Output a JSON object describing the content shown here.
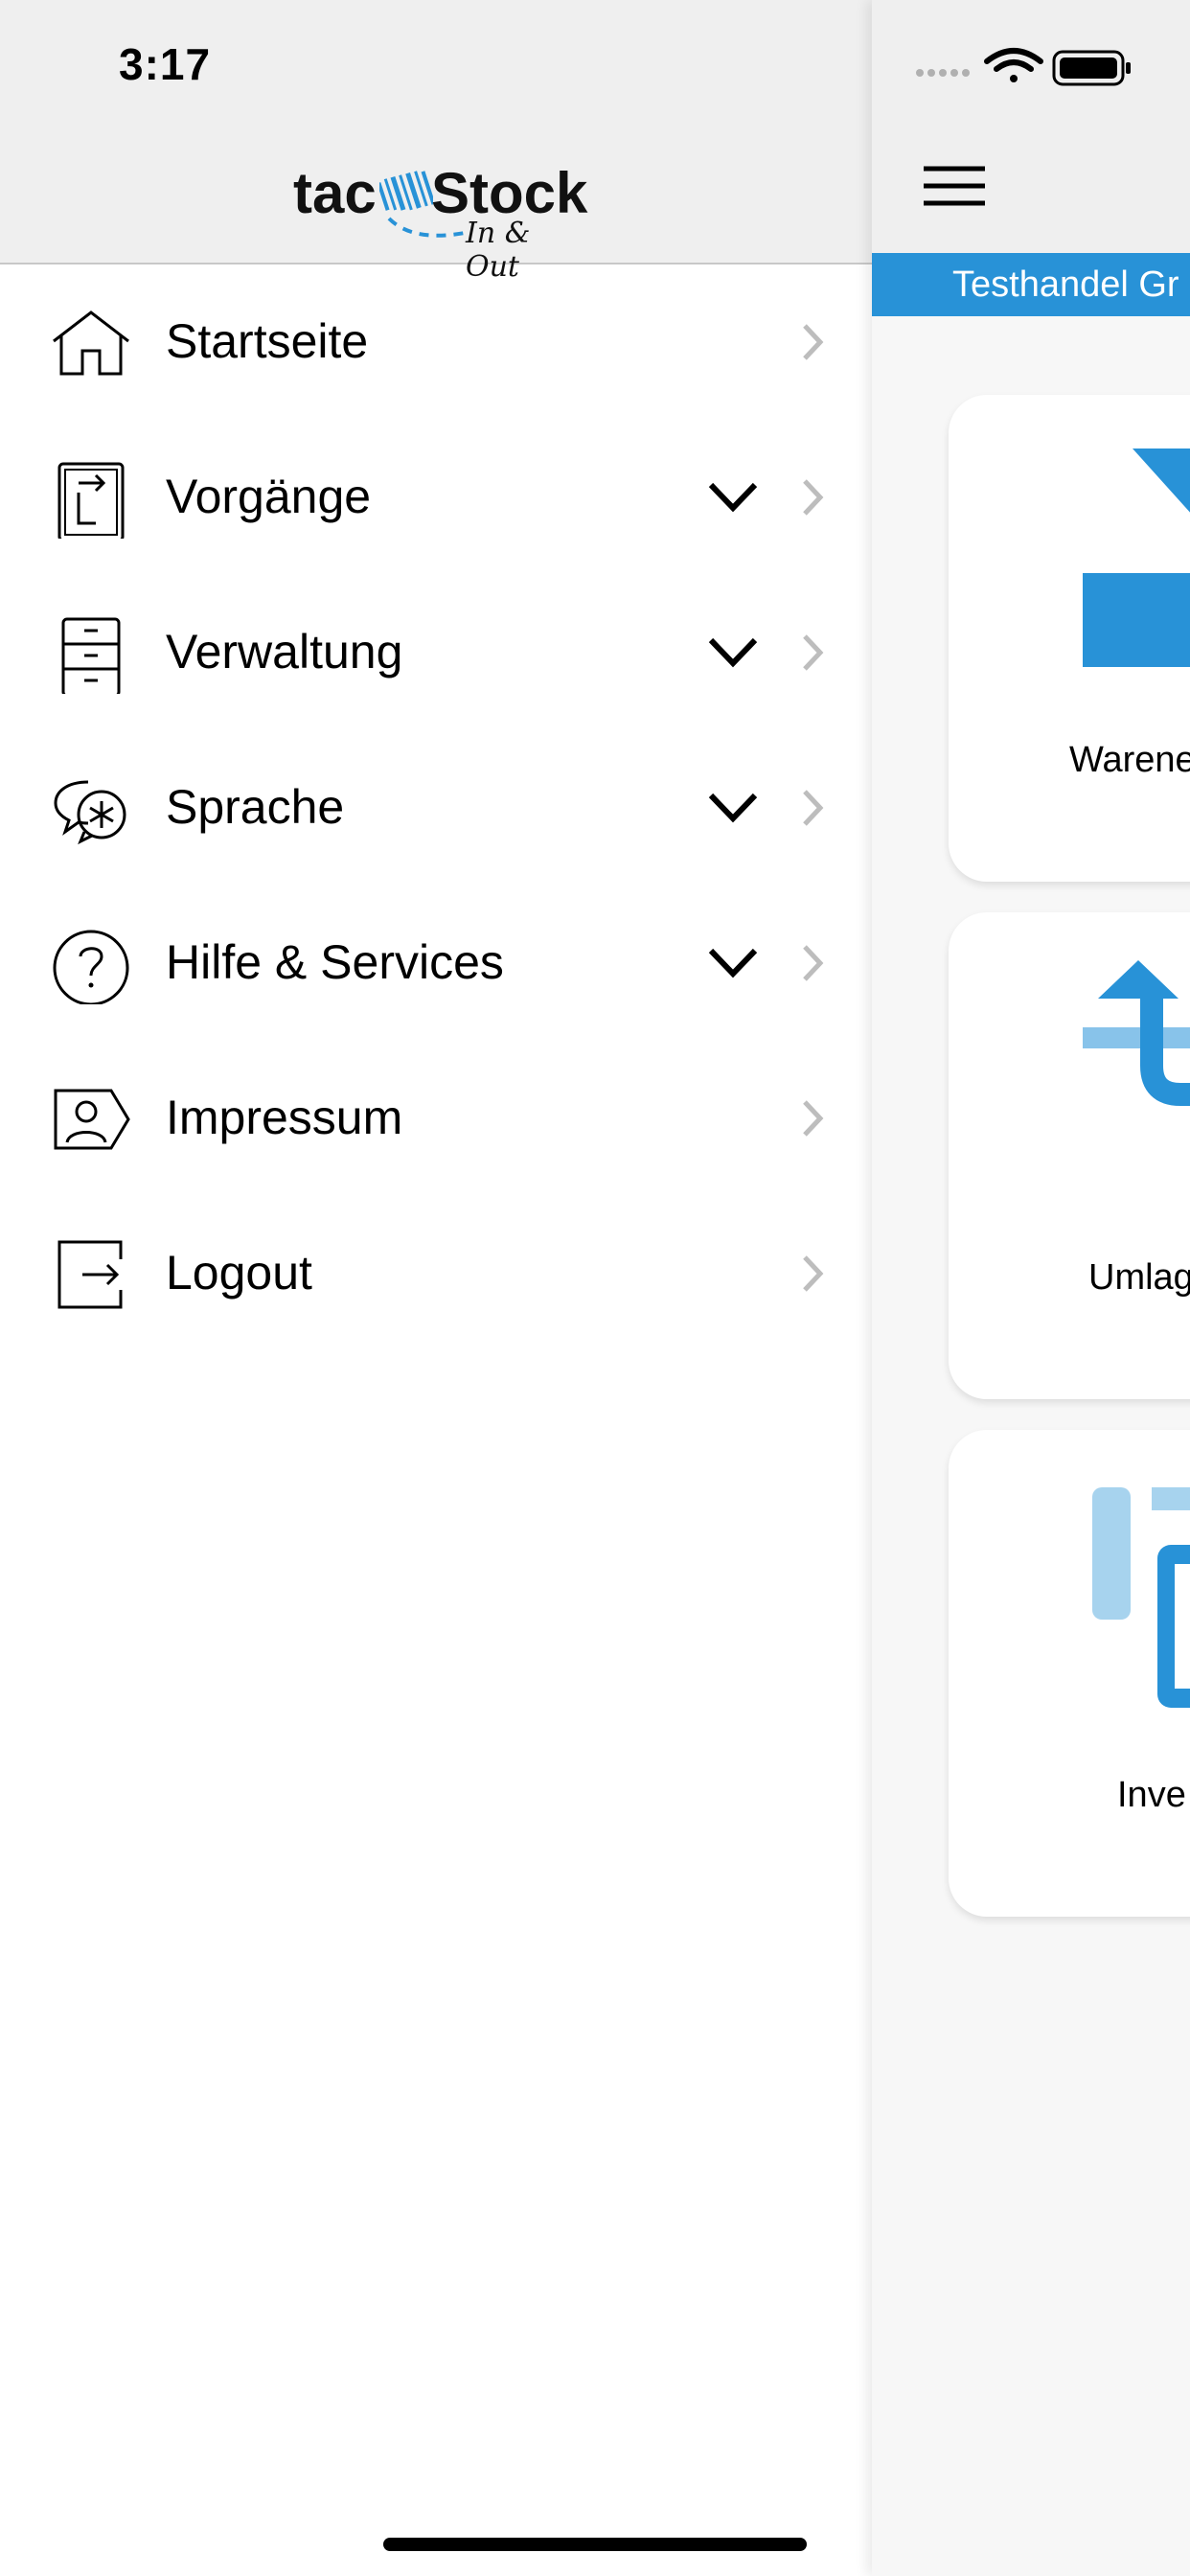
{
  "status_bar": {
    "time": "3:17"
  },
  "drawer": {
    "logo": {
      "part1": "tac",
      "part2": "Stock",
      "tagline": "In & Out"
    },
    "menu": [
      {
        "label": "Startseite",
        "icon": "home-icon",
        "expandable": false
      },
      {
        "label": "Vorgänge",
        "icon": "document-transfer-icon",
        "expandable": true
      },
      {
        "label": "Verwaltung",
        "icon": "filing-cabinet-icon",
        "expandable": true
      },
      {
        "label": "Sprache",
        "icon": "language-chat-icon",
        "expandable": true
      },
      {
        "label": "Hilfe & Services",
        "icon": "help-icon",
        "expandable": true
      },
      {
        "label": "Impressum",
        "icon": "imprint-id-icon",
        "expandable": false
      },
      {
        "label": "Logout",
        "icon": "logout-icon",
        "expandable": false
      }
    ]
  },
  "main": {
    "company_name": "Testhandel Gr",
    "tiles": [
      {
        "label": "Warene",
        "icon": "goods-receipt-icon"
      },
      {
        "label": "Umlag",
        "icon": "relocation-icon"
      },
      {
        "label": "Inve",
        "icon": "inventory-icon"
      }
    ]
  },
  "colors": {
    "accent": "#2892d7",
    "accent_light": "#a7d3ee"
  }
}
